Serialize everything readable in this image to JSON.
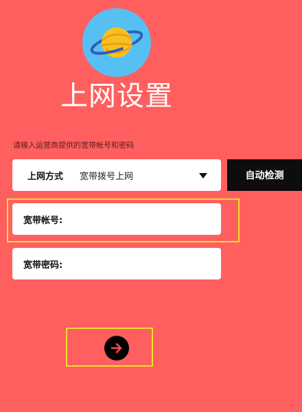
{
  "header": {
    "title": "上网设置",
    "logo_icon": "planet-icon"
  },
  "instruction": "请输入运营商提供的宽带帐号和密码",
  "connection_method": {
    "label": "上网方式",
    "value": "宽带拨号上网"
  },
  "auto_detect_label": "自动检测",
  "account_field": {
    "label": "宽带帐号:",
    "value": ""
  },
  "password_field": {
    "label": "宽带密码:",
    "value": ""
  },
  "next_icon": "arrow-right-icon",
  "colors": {
    "background": "#ff5f5f",
    "logo_circle": "#57c0f3",
    "planet": "#f6c21f",
    "ring": "#2f5fb8",
    "highlight": "#f0e02a",
    "button_dark": "#0d0d0d",
    "arrow": "#ff4d4d"
  }
}
